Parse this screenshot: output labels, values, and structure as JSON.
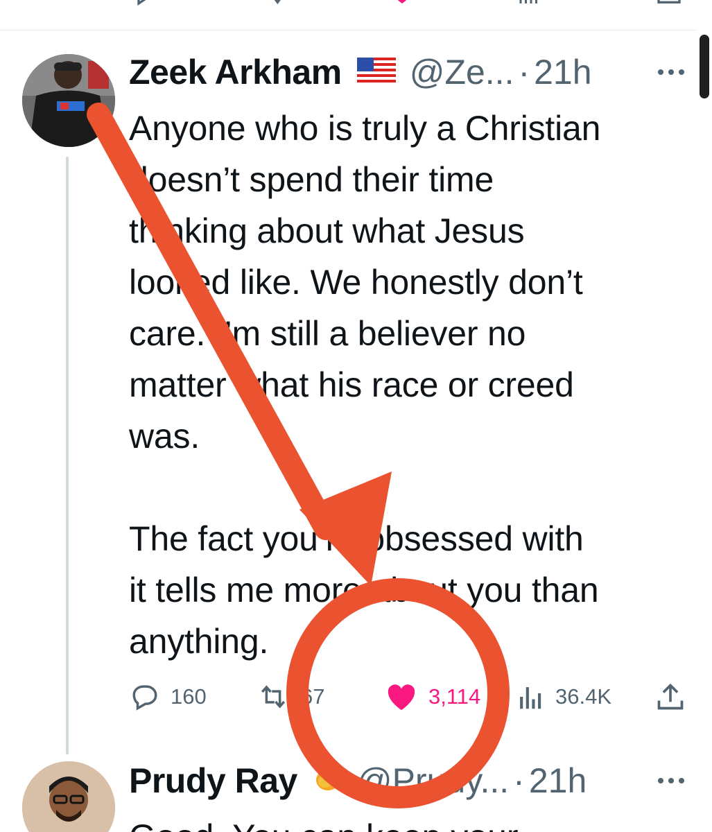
{
  "colors": {
    "annotation": "#ea5230",
    "like": "#f91880",
    "secondary_text": "#536471",
    "thread_line": "#cfd9de"
  },
  "top_actions_icons": [
    "reply-icon",
    "retweet-icon",
    "like-icon",
    "views-icon",
    "bookmark-icon"
  ],
  "tweet1": {
    "display_name": "Zeek Arkham",
    "flag_emoji": "🇺🇸",
    "handle": "@Ze...",
    "separator": "·",
    "time": "21h",
    "text": "Anyone who is truly a Christian\ndoesn’t spend their time\nthinking about what Jesus\nlooked like. We honestly don’t\ncare. I’m still a believer no\nmatter what his race or creed\nwas.\n\nThe fact you’re obsessed with\nit tells me more about you than\nanything.",
    "actions": {
      "replies": "160",
      "retweets": "67",
      "likes": "3,114",
      "views": "36.4K"
    }
  },
  "tweet2": {
    "display_name": "Prudy Ray",
    "emoji": "🥭",
    "handle": "@Prudy...",
    "separator": "·",
    "time": "21h",
    "text": "Good. You can keep your"
  }
}
